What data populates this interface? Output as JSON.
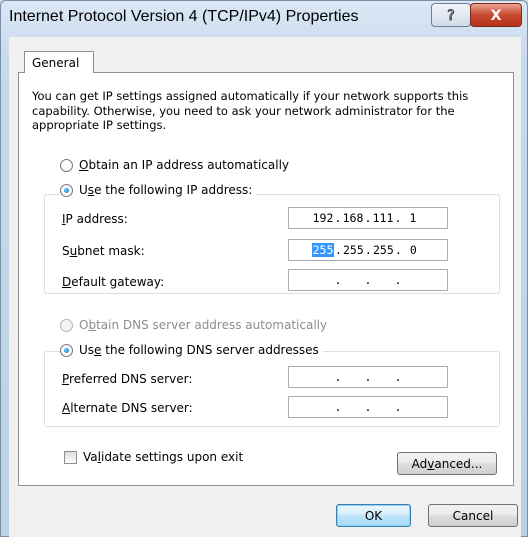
{
  "window": {
    "title": "Internet Protocol Version 4 (TCP/IPv4) Properties",
    "help_glyph": "?",
    "close_glyph": "X"
  },
  "tabs": [
    {
      "label": "General",
      "selected": true
    }
  ],
  "description": "You can get IP settings assigned automatically if your network supports this capability. Otherwise, you need to ask your network administrator for the appropriate IP settings.",
  "ip_mode": {
    "auto": {
      "pre": "",
      "accel": "O",
      "post": "btain an IP address automatically",
      "checked": false
    },
    "manual": {
      "pre": "U",
      "accel": "s",
      "post": "e the following IP address:",
      "checked": true
    }
  },
  "ip_fields": {
    "ip_address": {
      "pre": "",
      "accel": "I",
      "post": "P address:",
      "octets": [
        "192",
        "168",
        "111",
        "1"
      ]
    },
    "subnet_mask": {
      "pre": "S",
      "accel": "u",
      "post": "bnet mask:",
      "octets": [
        "255",
        "255",
        "255",
        "0"
      ],
      "selected_octet": 0
    },
    "default_gateway": {
      "pre": "",
      "accel": "D",
      "post": "efault gateway:",
      "octets": [
        "",
        "",
        "",
        ""
      ]
    }
  },
  "dns_mode": {
    "auto": {
      "pre": "O",
      "accel": "b",
      "post": "tain DNS server address automatically",
      "checked": false,
      "disabled": true
    },
    "manual": {
      "pre": "Us",
      "accel": "e",
      "post": " the following DNS server addresses",
      "checked": true
    }
  },
  "dns_fields": {
    "preferred": {
      "pre": "",
      "accel": "P",
      "post": "referred DNS server:",
      "octets": [
        "",
        "",
        "",
        ""
      ]
    },
    "alternate": {
      "pre": "",
      "accel": "A",
      "post": "lternate DNS server:",
      "octets": [
        "",
        "",
        "",
        ""
      ]
    }
  },
  "validate": {
    "pre": "Va",
    "accel": "l",
    "post": "idate settings upon exit",
    "checked": false
  },
  "buttons": {
    "advanced": {
      "pre": "Ad",
      "accel": "v",
      "post": "anced..."
    },
    "ok": "OK",
    "cancel": "Cancel"
  },
  "colors": {
    "selection": "#3399ff",
    "default_button_border": "#3c7fb1",
    "close_button": "#c84a32"
  }
}
